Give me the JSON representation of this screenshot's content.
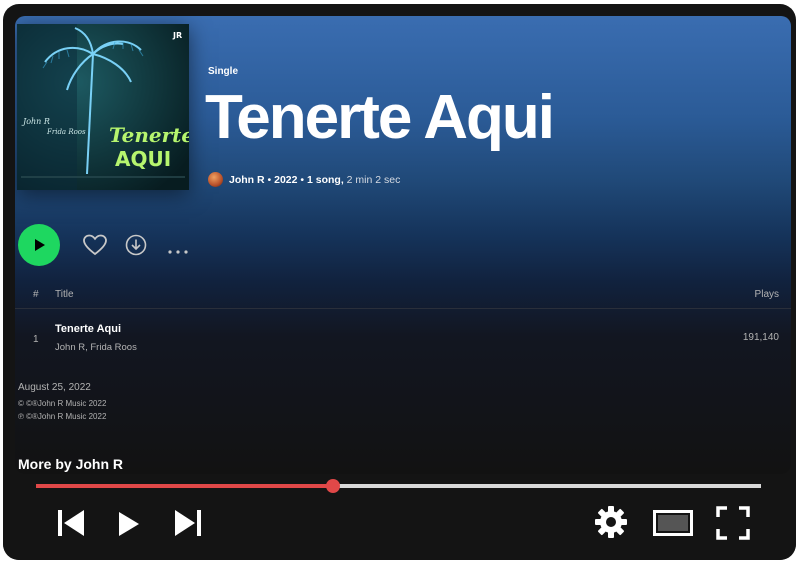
{
  "album": {
    "type_label": "Single",
    "title": "Tenerte Aqui",
    "artist": "John R",
    "year": "2022",
    "song_count": "1 song,",
    "duration": "2 min 2 sec",
    "cover": {
      "monogram": "JR",
      "script_line_1": "John R",
      "script_line_2": "Frida Roos",
      "word_1": "Tenerte",
      "word_2": "AQUI"
    }
  },
  "actions": {
    "play_icon": "play-icon",
    "like_icon": "heart-icon",
    "download_icon": "download-icon",
    "more_icon": "more-icon"
  },
  "tracklist": {
    "headers": {
      "number": "#",
      "title": "Title",
      "plays": "Plays"
    },
    "tracks": [
      {
        "number": "1",
        "title": "Tenerte Aqui",
        "artists": "John R, Frida Roos",
        "plays": "191,140"
      }
    ]
  },
  "release": {
    "date": "August 25, 2022",
    "copyright": "© ©®John R Music 2022",
    "phonogram": "℗ ©®John R Music 2022"
  },
  "more_by": "More by John R",
  "player": {
    "progress": 0.41,
    "accent_color": "#e04848",
    "buttons": [
      "previous-icon",
      "play-icon",
      "next-icon",
      "settings-icon",
      "theater-mode-icon",
      "fullscreen-icon"
    ]
  },
  "colors": {
    "header_blue": "#3a6db1",
    "play_green": "#1ed760",
    "background": "#121212"
  }
}
